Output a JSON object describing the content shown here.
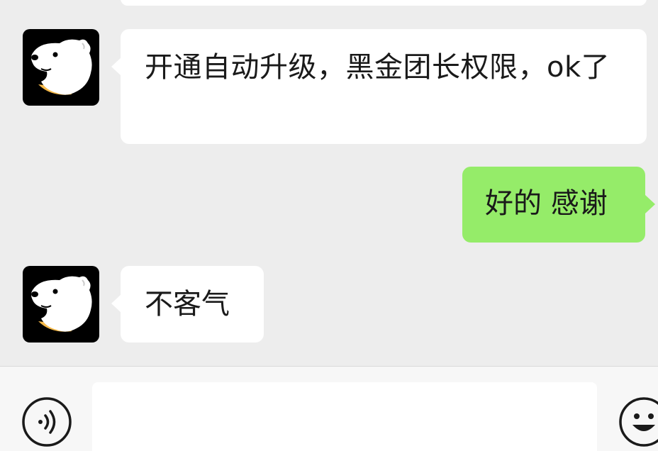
{
  "chat": {
    "messages": [
      {
        "sender": "contact",
        "text": "开通自动升级，黑金团长权限，ok了"
      },
      {
        "sender": "me",
        "text": "好的 感谢"
      },
      {
        "sender": "contact",
        "text": "不客气"
      }
    ]
  },
  "input_bar": {
    "text_value": "",
    "voice_icon": "voice-icon",
    "emoji_icon": "emoji-icon"
  },
  "colors": {
    "background": "#ededed",
    "incoming_bubble": "#ffffff",
    "outgoing_bubble": "#95ec69",
    "avatar_bg": "#000000"
  }
}
